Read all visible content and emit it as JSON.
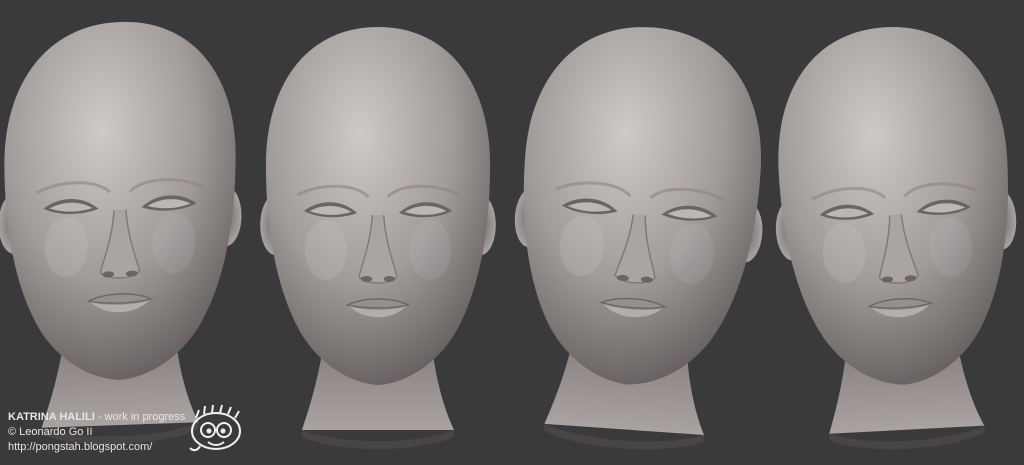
{
  "credits": {
    "name": "KATRINA HALILI",
    "status": " - work in progress",
    "copyright": "© Leonardo Go II",
    "url": "http://pongstah.blogspot.com/"
  },
  "views": [
    {
      "id": "three-quarter-right",
      "icon": "head-render-icon"
    },
    {
      "id": "front",
      "icon": "head-render-icon"
    },
    {
      "id": "three-quarter-left",
      "icon": "head-render-icon"
    },
    {
      "id": "three-quarter-left-down",
      "icon": "head-render-icon"
    }
  ],
  "colors": {
    "background": "#3a3a3c",
    "clay": "#a09a9a",
    "clay_shadow": "#5e5858",
    "clay_highlight": "#d2cdcc",
    "text": "#e6e6e6"
  }
}
